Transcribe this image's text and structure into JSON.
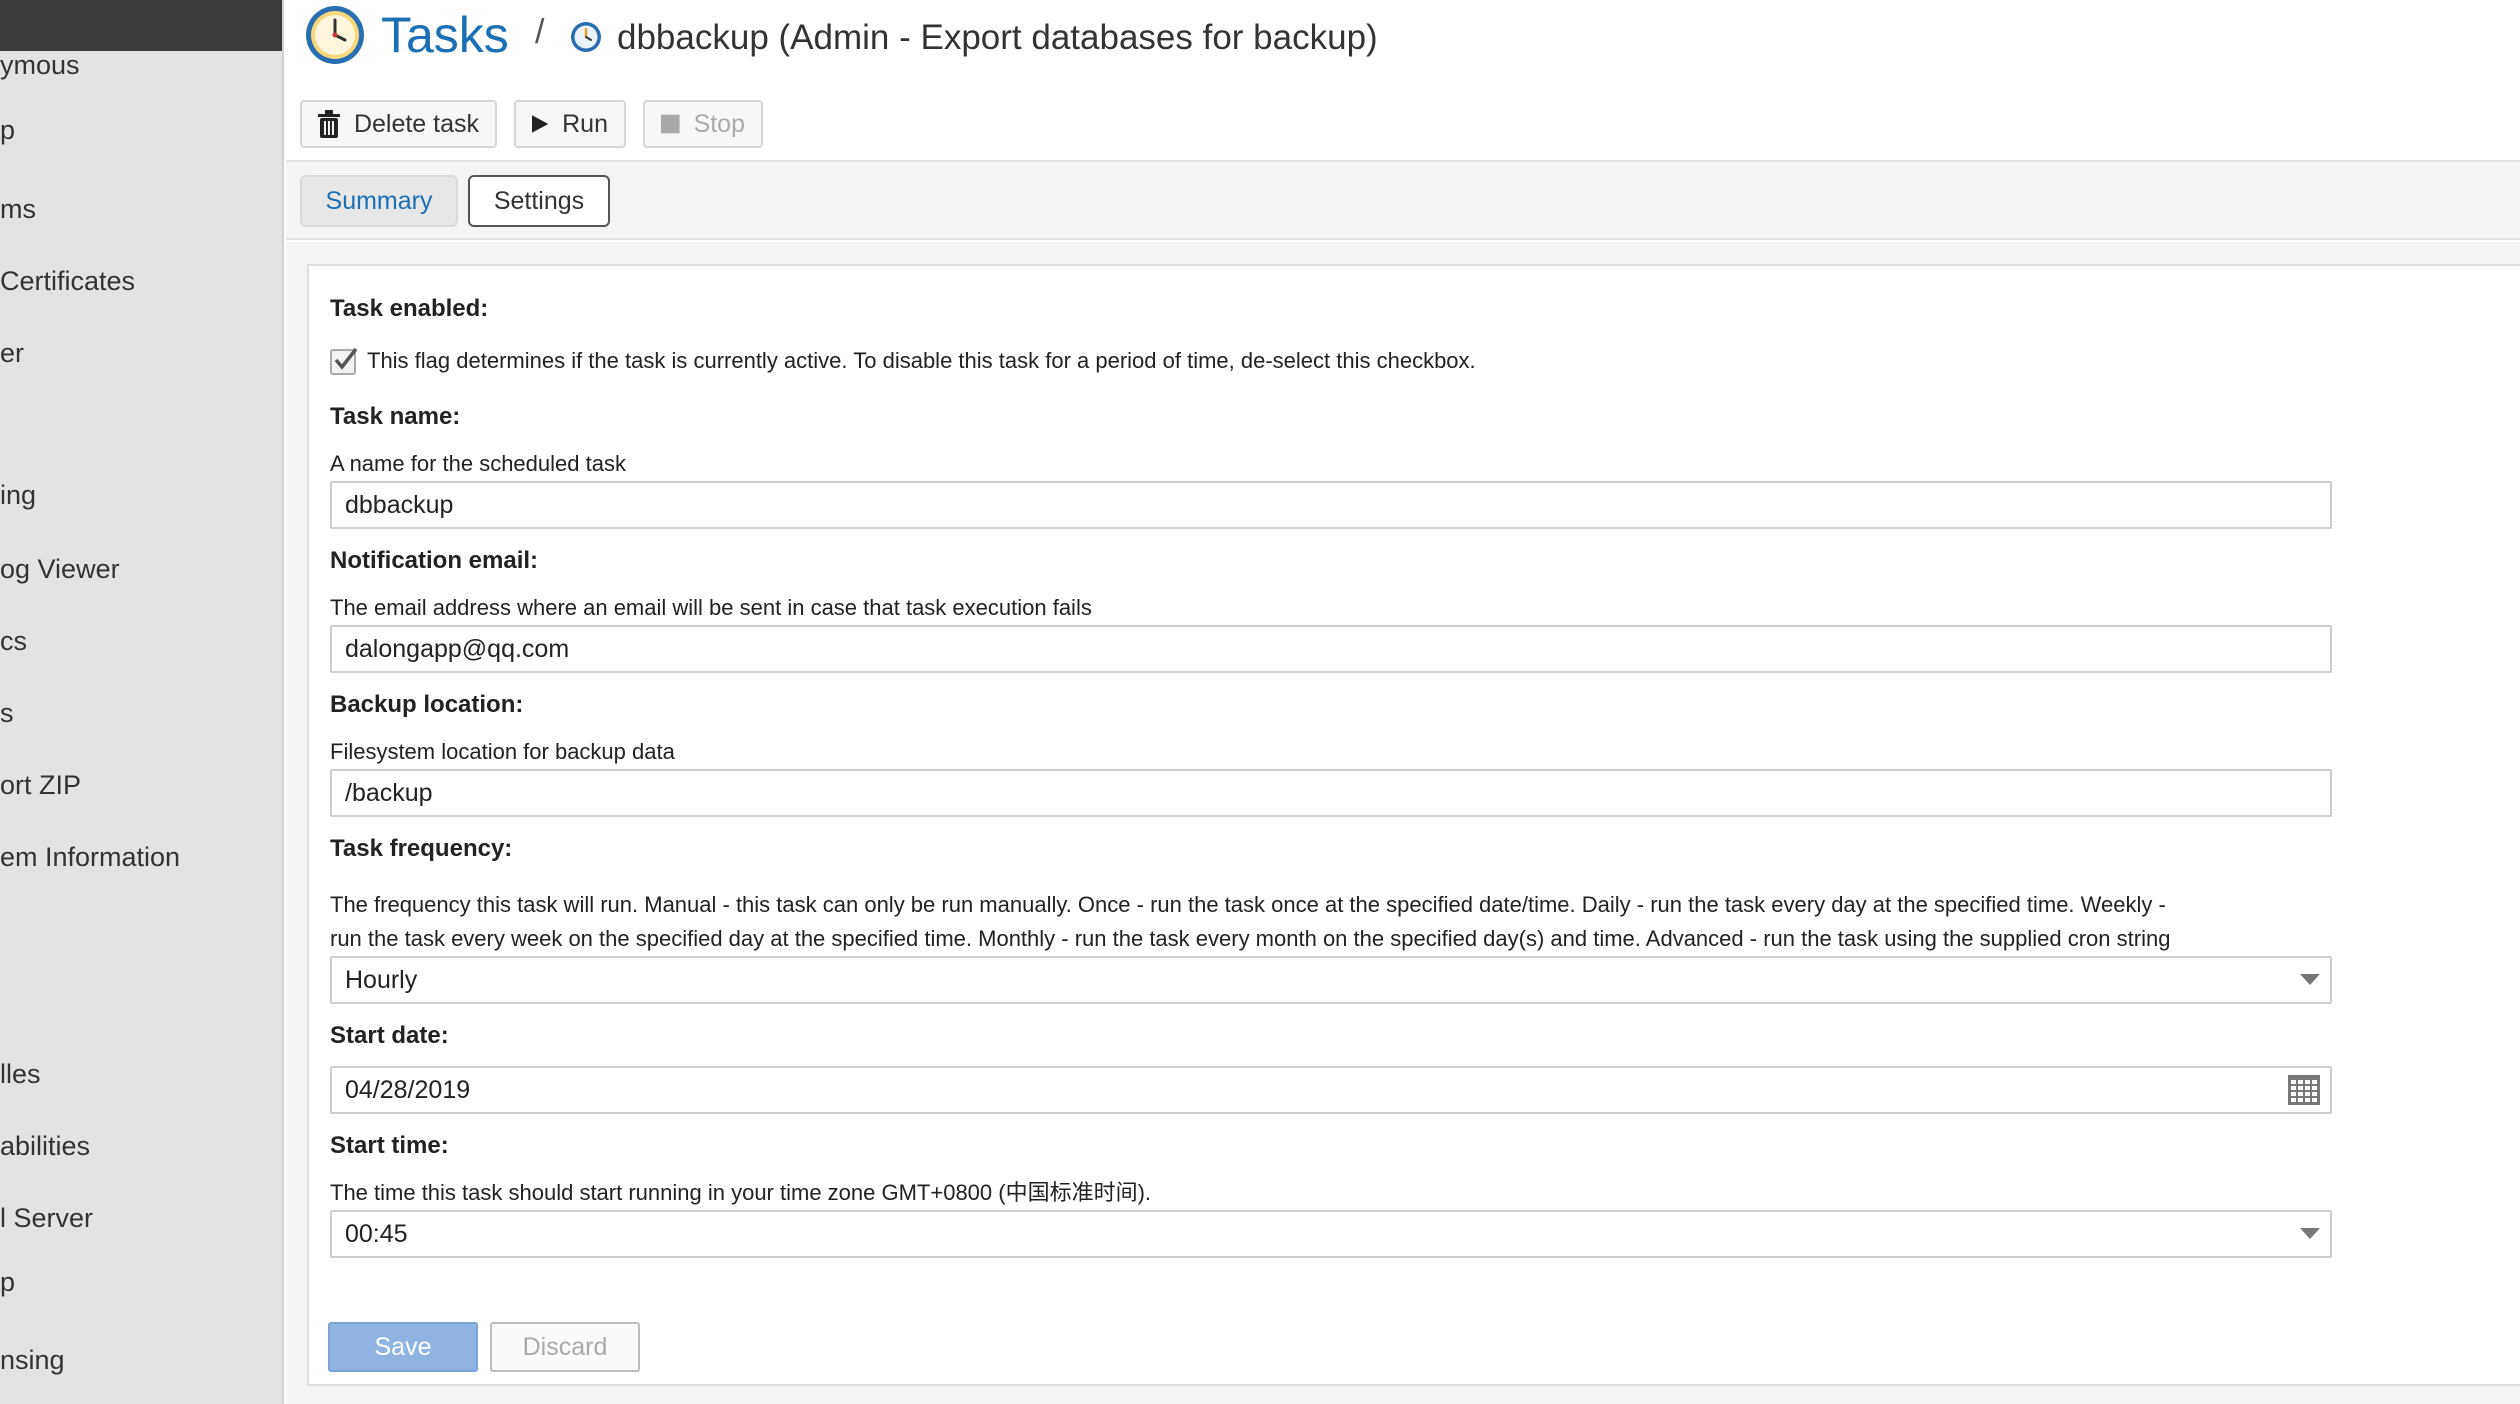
{
  "sidebar": {
    "items": [
      {
        "label": "ymous"
      },
      {
        "label": "p"
      },
      {
        "label": "ms"
      },
      {
        "label": "Certificates"
      },
      {
        "label": "er"
      },
      {
        "label": "ing"
      },
      {
        "label": "og Viewer"
      },
      {
        "label": "cs"
      },
      {
        "label": "s"
      },
      {
        "label": "ort ZIP"
      },
      {
        "label": "em Information"
      },
      {
        "label": "lles"
      },
      {
        "label": "abilities"
      },
      {
        "label": "l Server"
      },
      {
        "label": "p"
      },
      {
        "label": "nsing"
      }
    ]
  },
  "header": {
    "title": "Tasks",
    "separator": "/",
    "breadcrumb": "dbbackup (Admin - Export databases for backup)",
    "icons": {
      "title": "clock-icon",
      "breadcrumb": "clock-icon"
    },
    "accent_color": "#1a6fb5"
  },
  "toolbar": {
    "delete_label": "Delete task",
    "run_label": "Run",
    "stop_label": "Stop"
  },
  "tabs": [
    {
      "label": "Summary"
    },
    {
      "label": "Settings"
    }
  ],
  "form": {
    "enabled": {
      "label": "Task enabled:",
      "checked": true,
      "help": "This flag determines if the task is currently active. To disable this task for a period of time, de-select this checkbox."
    },
    "name": {
      "label": "Task name:",
      "help": "A name for the scheduled task",
      "value": "dbbackup"
    },
    "email": {
      "label": "Notification email:",
      "help": "The email address where an email will be sent in case that task execution fails",
      "value": "dalongapp@qq.com"
    },
    "backup": {
      "label": "Backup location:",
      "help": "Filesystem location for backup data",
      "value": "/backup"
    },
    "frequency": {
      "label": "Task frequency:",
      "help_line1": "The frequency this task will run. Manual - this task can only be run manually. Once - run the task once at the specified date/time. Daily - run the task every day at the specified time. Weekly -",
      "help_line2": "run the task every week on the specified day at the specified time. Monthly - run the task every month on the specified day(s) and time. Advanced - run the task using the supplied cron string",
      "value": "Hourly"
    },
    "start_date": {
      "label": "Start date:",
      "value": "04/28/2019"
    },
    "start_time": {
      "label": "Start time:",
      "help": "The time this task should start running in your time zone GMT+0800 (中国标准时间).",
      "value": "00:45"
    },
    "save_label": "Save",
    "discard_label": "Discard"
  }
}
